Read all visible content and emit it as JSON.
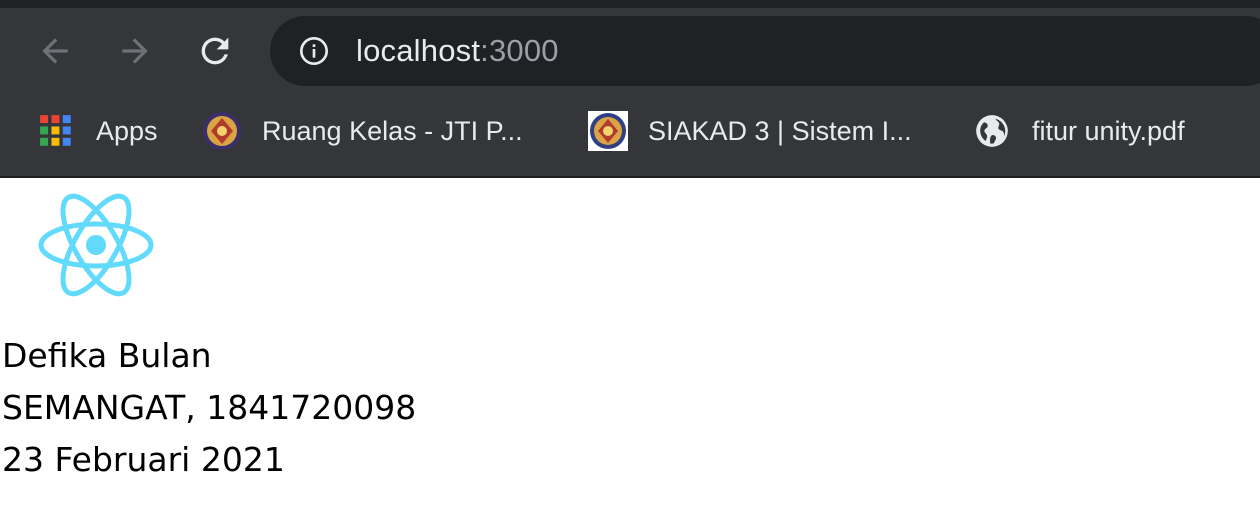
{
  "browser": {
    "url_host": "localhost",
    "url_port": ":3000",
    "bookmarks": [
      {
        "label": "Apps",
        "icon": "apps-grid-icon"
      },
      {
        "label": "Ruang Kelas - JTI P...",
        "icon": "polinema-logo-icon"
      },
      {
        "label": "SIAKAD 3 | Sistem I...",
        "icon": "polinema-logo-icon"
      },
      {
        "label": "fitur unity.pdf",
        "icon": "globe-icon"
      }
    ]
  },
  "page": {
    "logo_icon": "react-logo-icon",
    "lines": [
      "Defika Bulan",
      "SEMANGAT, 1841720098",
      "23 Februari 2021"
    ]
  },
  "colors": {
    "chrome_bg": "#35363a",
    "omnibox_bg": "#202124",
    "react_accent": "#61dafb"
  }
}
